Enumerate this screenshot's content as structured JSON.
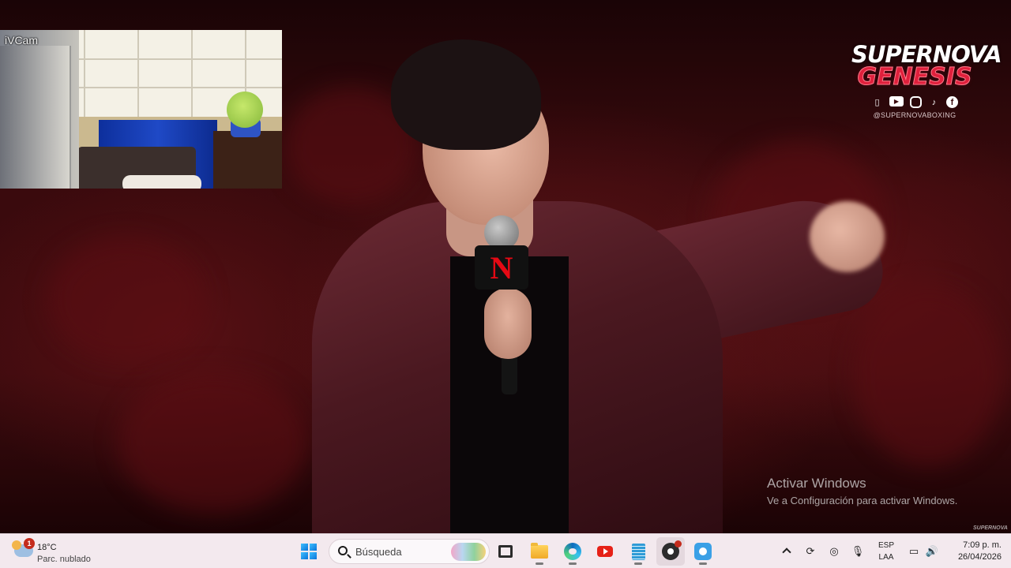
{
  "video": {
    "webcam_label": "iVCam",
    "brand": {
      "line1": "SUPERNOVA",
      "line2": "GENESIS",
      "handle": "@SUPERNOVABOXING",
      "socials": [
        "twitch-icon",
        "youtube-icon",
        "instagram-icon",
        "tiktok-icon",
        "facebook-icon"
      ]
    },
    "mic_flag_letter": "N",
    "corner_mark": "SUPERNOVA"
  },
  "activation": {
    "title": "Activar Windows",
    "subtitle": "Ve a Configuración para activar Windows."
  },
  "taskbar": {
    "weather": {
      "temp": "18°C",
      "desc": "Parc. nublado",
      "badge": "1"
    },
    "search_placeholder": "Búsqueda",
    "apps": [
      "start-icon",
      "task-view-icon",
      "file-explorer-icon",
      "edge-icon",
      "youtube-icon",
      "notepad-icon",
      "obs-icon",
      "ivcam-icon"
    ],
    "tray": {
      "language": "ESP",
      "layout": "LAA",
      "time": "7:09 p. m.",
      "date": "26/04/2026"
    }
  },
  "colors": {
    "taskbar_bg": "#f3e9ee",
    "brand_red": "#e0203c",
    "accent_blue": "#0f6cbd"
  }
}
